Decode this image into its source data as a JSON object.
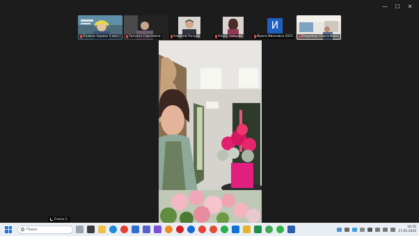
{
  "window": {
    "minimize_glyph": "—",
    "maximize_glyph": "☐",
    "close_glyph": "✕"
  },
  "participants": [
    {
      "name": "Полина Зорина 5 мая 2024",
      "kind": "video"
    },
    {
      "name": "Татьяна Сергеевна",
      "kind": "video"
    },
    {
      "name": "Алексей Петров",
      "kind": "video"
    },
    {
      "name": "Ольга Зайцева",
      "kind": "video"
    },
    {
      "name": "Ирина Ивановна 2025",
      "kind": "avatar",
      "initial": "И"
    },
    {
      "name": "Владимир Ольга Иванова",
      "kind": "video"
    }
  ],
  "self_view": {
    "label": "Елена С."
  },
  "taskbar": {
    "search_placeholder": "Поиск",
    "icons": [
      "task-view",
      "file-explorer",
      "edge",
      "chrome",
      "store",
      "teams",
      "firefox",
      "opera",
      "yandex",
      "whatsapp",
      "outlook",
      "excel",
      "word",
      "whatsapp-2",
      "telegram"
    ],
    "time": "16:35",
    "date": "17.05.2024"
  },
  "colors": {
    "background": "#1c1c1c",
    "taskbar": "#e9eef4",
    "accent": "#1f5fbf"
  }
}
